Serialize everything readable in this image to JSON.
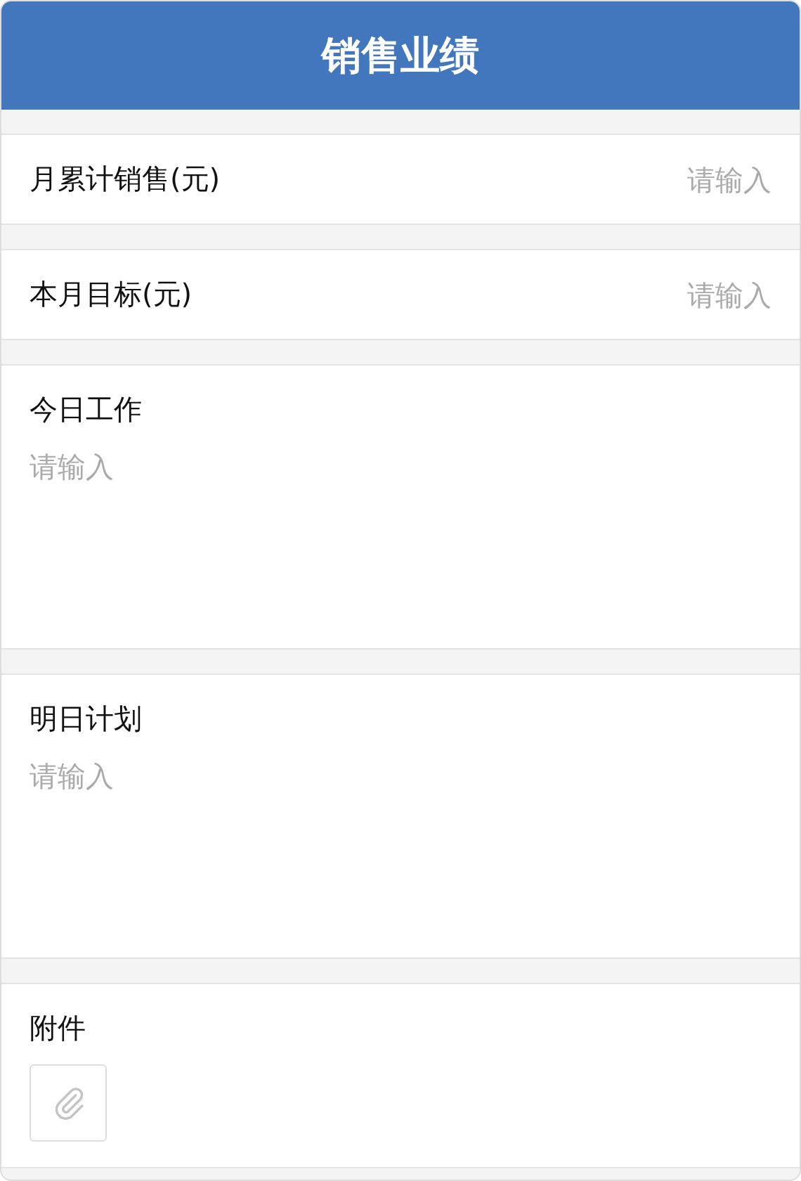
{
  "header": {
    "title": "销售业绩"
  },
  "fields": [
    {
      "kind": "inline",
      "label": "月累计销售(元)",
      "placeholder": "请输入"
    },
    {
      "kind": "inline",
      "label": "本月目标(元)",
      "placeholder": "请输入"
    },
    {
      "kind": "textarea",
      "label": "今日工作",
      "placeholder": "请输入"
    },
    {
      "kind": "textarea",
      "label": "明日计划",
      "placeholder": "请输入"
    },
    {
      "kind": "attachment",
      "label": "附件"
    }
  ]
}
